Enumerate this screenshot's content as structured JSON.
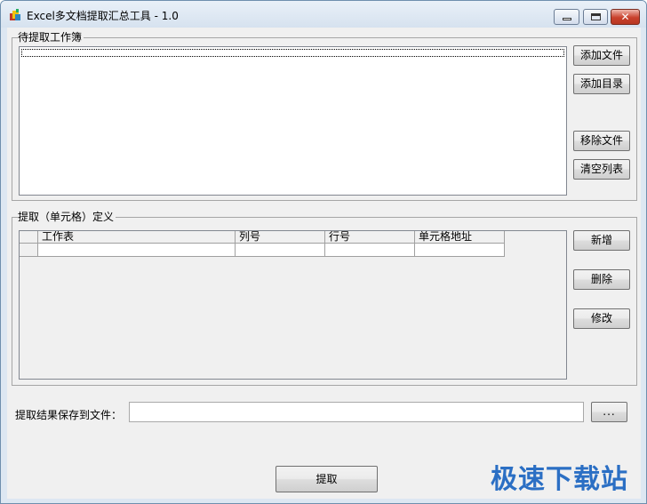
{
  "window": {
    "title": "Excel多文档提取汇总工具 - 1.0",
    "close_symbol": "✕"
  },
  "workbooks": {
    "legend": "待提取工作簿",
    "buttons": {
      "add_file": "添加文件",
      "add_dir": "添加目录",
      "remove_file": "移除文件",
      "clear_list": "清空列表"
    }
  },
  "definition": {
    "legend": "提取（单元格）定义",
    "columns": [
      "工作表",
      "列号",
      "行号",
      "单元格地址"
    ],
    "buttons": {
      "add": "新增",
      "delete": "删除",
      "edit": "修改"
    }
  },
  "output": {
    "label": "提取结果保存到文件：",
    "value": "",
    "browse": "..."
  },
  "extract_button": "提取",
  "watermark": "极速下载站",
  "colors": {
    "face": "#f0f0f0",
    "frame": "#dde7f2",
    "close": "#c9412c",
    "watermark": "#2b6fc4"
  }
}
